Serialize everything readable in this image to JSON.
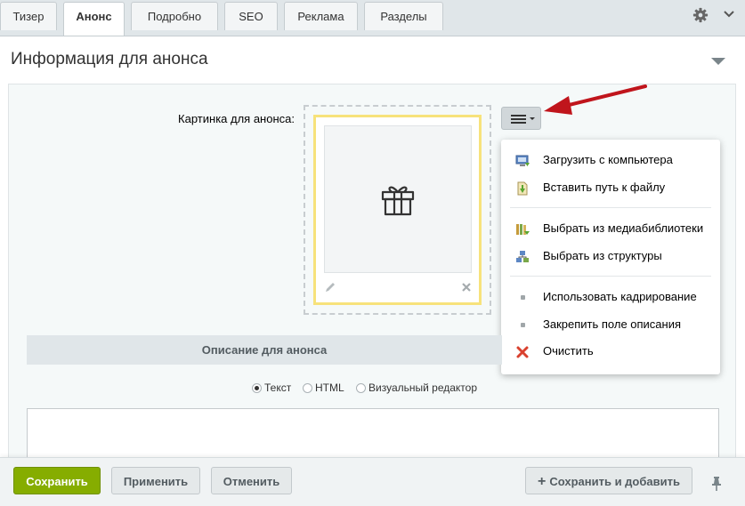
{
  "tabs": [
    {
      "label": "Тизер"
    },
    {
      "label": "Анонс"
    },
    {
      "label": "Подробно"
    },
    {
      "label": "SEO"
    },
    {
      "label": "Реклама"
    },
    {
      "label": "Разделы"
    }
  ],
  "active_tab": "Анонс",
  "section": {
    "title": "Информация для анонса"
  },
  "picture": {
    "label": "Картинка для анонса:",
    "placeholder_icon": "gift-icon"
  },
  "menu": {
    "items": [
      {
        "label": "Загрузить с компьютера",
        "icon": "computer-upload-icon"
      },
      {
        "label": "Вставить путь к файлу",
        "icon": "file-path-icon"
      },
      {
        "label": "Выбрать из медиабиблиотеки",
        "icon": "medialib-icon"
      },
      {
        "label": "Выбрать из структуры",
        "icon": "structure-icon"
      },
      {
        "label": "Использовать кадрирование",
        "icon": "bullet-icon"
      },
      {
        "label": "Закрепить поле описания",
        "icon": "bullet-icon"
      },
      {
        "label": "Очистить",
        "icon": "clear-icon"
      }
    ]
  },
  "description": {
    "title": "Описание для анонса",
    "modes": [
      {
        "label": "Текст",
        "selected": true
      },
      {
        "label": "HTML",
        "selected": false
      },
      {
        "label": "Визуальный редактор",
        "selected": false
      }
    ],
    "value": ""
  },
  "footer": {
    "save": "Сохранить",
    "apply": "Применить",
    "cancel": "Отменить",
    "save_add": "Сохранить и добавить"
  },
  "colors": {
    "accent_green": "#86ad00",
    "annotation_arrow": "#c0151c",
    "image_frame": "#f7e27b"
  }
}
